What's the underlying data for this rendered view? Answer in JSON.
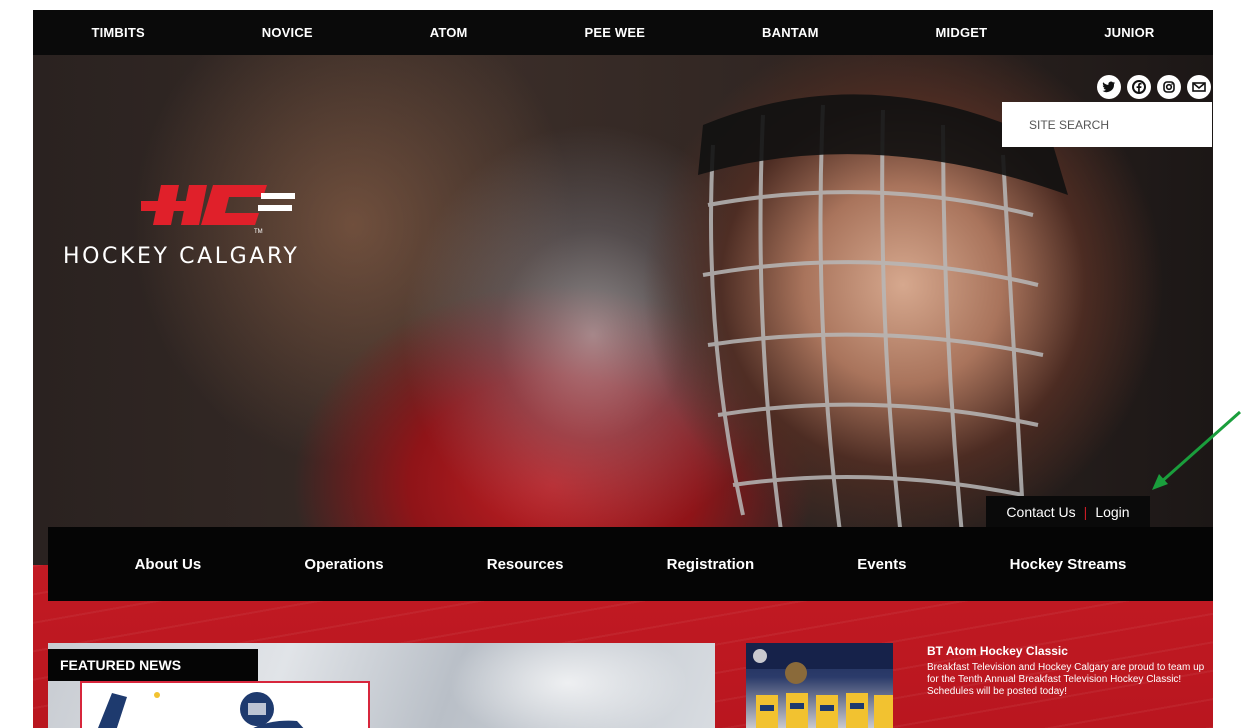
{
  "top_nav": [
    "TIMBITS",
    "NOVICE",
    "ATOM",
    "PEE WEE",
    "BANTAM",
    "MIDGET",
    "JUNIOR"
  ],
  "brand": {
    "name": "HOCKEY CALGARY",
    "logo_letters": "HC",
    "trademark": "TM"
  },
  "social": [
    "twitter-icon",
    "facebook-icon",
    "instagram-icon",
    "email-icon"
  ],
  "search": {
    "placeholder": "SITE SEARCH"
  },
  "utility": {
    "contact": "Contact Us",
    "separator": "|",
    "login": "Login"
  },
  "main_nav": [
    "About Us",
    "Operations",
    "Resources",
    "Registration",
    "Events",
    "Hockey Streams"
  ],
  "featured": {
    "label": "FEATURED NEWS"
  },
  "news": {
    "title": "BT Atom Hockey Classic",
    "body": "Breakfast Television and Hockey Calgary are proud to team up for the Tenth Annual Breakfast Television Hockey Classic!  Schedules will be posted today!"
  },
  "colors": {
    "brand_red": "#c21a23",
    "nav_black": "#0a0a0a",
    "annotation_arrow": "#1a9e3c"
  }
}
